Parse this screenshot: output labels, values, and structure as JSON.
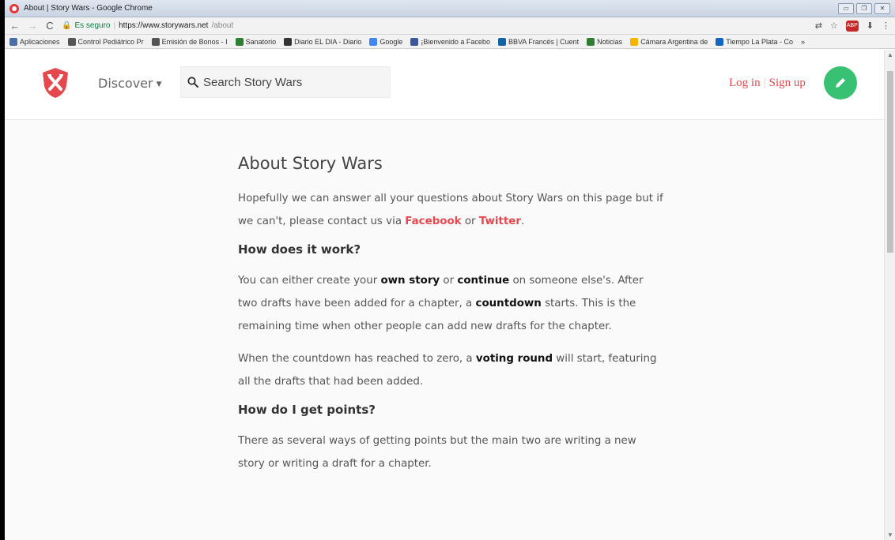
{
  "window": {
    "title": "About | Story Wars - Google Chrome",
    "controls": [
      "▭",
      "❐",
      "✕"
    ]
  },
  "addressbar": {
    "back": "←",
    "forward": "→",
    "reload": "C",
    "secure_label": "Es seguro",
    "url_host": "https://www.storywars.net",
    "url_path": "/about"
  },
  "bookmarks": [
    {
      "label": "Aplicaciones",
      "color": "#4a6fa5"
    },
    {
      "label": "Control Pediátrico Pr",
      "color": "#555555"
    },
    {
      "label": "Emisión de Bonos - I",
      "color": "#555555"
    },
    {
      "label": "Sanatorio",
      "color": "#2e7d32"
    },
    {
      "label": "Diario EL DIA - Diario",
      "color": "#333333"
    },
    {
      "label": "Google",
      "color": "#4285f4"
    },
    {
      "label": "¡Bienvenido a Facebo",
      "color": "#3b5998"
    },
    {
      "label": "BBVA Francés | Cuent",
      "color": "#1464a5"
    },
    {
      "label": "Noticias",
      "color": "#2e7d32"
    },
    {
      "label": "Cámara Argentina de",
      "color": "#f4b400"
    },
    {
      "label": "Tiempo La Plata - Co",
      "color": "#1565c0"
    }
  ],
  "header": {
    "discover_label": "Discover",
    "search_placeholder": "Search Story Wars",
    "login_label": "Log in",
    "signup_label": "Sign up"
  },
  "content": {
    "title": "About Story Wars",
    "intro_before": "Hopefully we can answer all your questions about Story Wars on this page but if we can't, please contact us via ",
    "facebook_link": "Facebook",
    "intro_or": " or ",
    "twitter_link": "Twitter",
    "intro_end": ".",
    "h_how": "How does it work?",
    "p1_a": "You can either create your ",
    "p1_b": "own story",
    "p1_c": " or ",
    "p1_d": "continue",
    "p1_e": " on someone else's. After two drafts have been added for a chapter, a ",
    "p1_f": "countdown",
    "p1_g": " starts. This is the remaining time when other people can add new drafts for the chapter.",
    "p2_a": "When the countdown has reached to zero, a ",
    "p2_b": "voting round",
    "p2_c": " will start, featuring all the drafts that had been added.",
    "h_points": "How do I get points?",
    "p3": "There as several ways of getting points but the main two are writing a new story or writing a draft for a chapter."
  },
  "colors": {
    "accent": "#e5484d",
    "write_button": "#38c172"
  }
}
